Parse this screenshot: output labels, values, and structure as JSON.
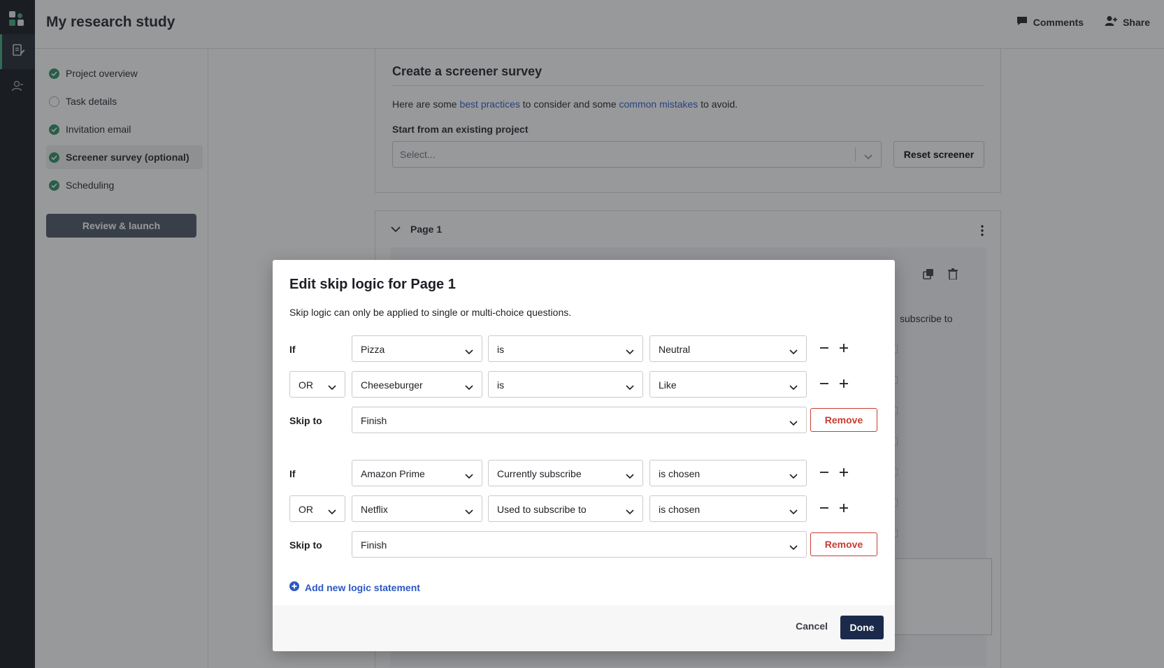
{
  "header": {
    "title": "My research study",
    "comments_label": "Comments",
    "share_label": "Share"
  },
  "sidebar": {
    "steps": [
      {
        "label": "Project overview",
        "status": "done"
      },
      {
        "label": "Task details",
        "status": "todo"
      },
      {
        "label": "Invitation email",
        "status": "done"
      },
      {
        "label": "Screener survey (optional)",
        "status": "done",
        "current": true
      },
      {
        "label": "Scheduling",
        "status": "done"
      }
    ],
    "review_label": "Review & launch"
  },
  "screener": {
    "heading": "Create a screener survey",
    "intro_pre": "Here are some ",
    "link1": "best practices",
    "intro_mid": " to consider and some ",
    "link2": "common mistakes",
    "intro_post": " to avoid.",
    "start_label": "Start from an existing project",
    "select_placeholder": "Select...",
    "reset_label": "Reset screener"
  },
  "page": {
    "label": "Page 1",
    "partial_text": "subscribe to"
  },
  "modal": {
    "title": "Edit skip logic for Page 1",
    "description": "Skip logic can only be applied to single or multi-choice questions.",
    "blocks": [
      {
        "conditions": [
          {
            "label": "If",
            "question": "Pizza",
            "operator": "is",
            "value": "Neutral"
          },
          {
            "connector": "OR",
            "question": "Cheeseburger",
            "operator": "is",
            "value": "Like"
          }
        ],
        "skip_label": "Skip to",
        "skip_to": "Finish",
        "remove_label": "Remove"
      },
      {
        "conditions": [
          {
            "label": "If",
            "question": "Amazon Prime",
            "operator": "Currently subscribe",
            "value": "is chosen"
          },
          {
            "connector": "OR",
            "question": "Netflix",
            "operator": "Used to subscribe to",
            "value": "is chosen"
          }
        ],
        "skip_label": "Skip to",
        "skip_to": "Finish",
        "remove_label": "Remove"
      }
    ],
    "add_label": "Add new logic statement",
    "cancel_label": "Cancel",
    "done_label": "Done"
  },
  "colors": {
    "accent": "#2b58c5",
    "success": "#2a8f60",
    "danger": "#c83c32",
    "primary": "#1b2a4a"
  }
}
